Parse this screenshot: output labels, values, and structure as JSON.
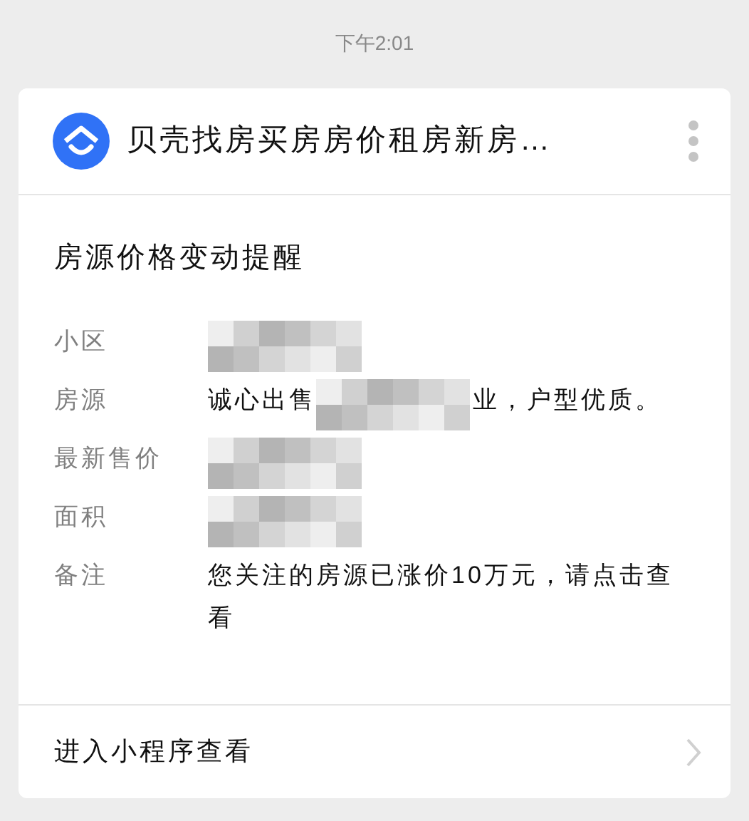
{
  "status_bar": {
    "time": "下午2:01"
  },
  "card": {
    "app_name": "贝壳找房买房房价租房新房…",
    "title": "房源价格变动提醒",
    "fields": [
      {
        "label": "小区",
        "parts": [
          {
            "kind": "redacted"
          }
        ]
      },
      {
        "label": "房源",
        "parts": [
          {
            "kind": "text",
            "text": "诚心出售"
          },
          {
            "kind": "redacted"
          },
          {
            "kind": "text",
            "text": "业，户型优质。"
          }
        ]
      },
      {
        "label": "最新售价",
        "parts": [
          {
            "kind": "redacted"
          }
        ]
      },
      {
        "label": "面积",
        "parts": [
          {
            "kind": "redacted"
          }
        ]
      },
      {
        "label": "备注",
        "parts": [
          {
            "kind": "text",
            "text": "您关注的房源已涨价10万元，请点击查看"
          }
        ]
      }
    ],
    "footer_link": "进入小程序查看"
  }
}
